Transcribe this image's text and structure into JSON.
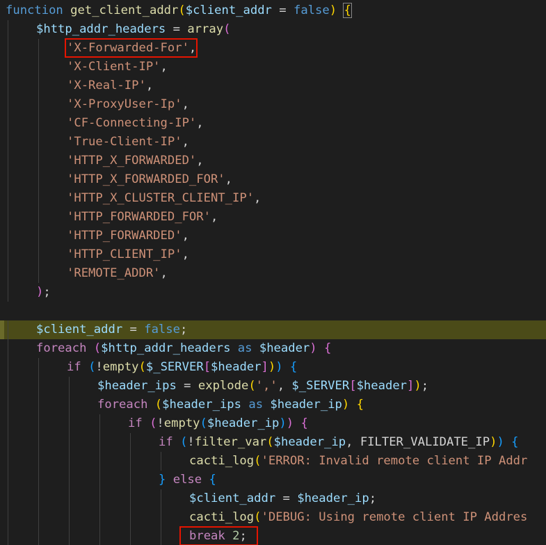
{
  "editor": {
    "lines": [
      [
        [
          "kw",
          "function"
        ],
        [
          "pl",
          " "
        ],
        [
          "fn",
          "get_client_addr"
        ],
        [
          "b1",
          "("
        ],
        [
          "var",
          "$client_addr"
        ],
        [
          "pl",
          " = "
        ],
        [
          "kw",
          "false"
        ],
        [
          "b1",
          ")"
        ],
        [
          "pl",
          " "
        ],
        [
          "b1",
          "{"
        ]
      ],
      [
        [
          "var",
          "$http_addr_headers"
        ],
        [
          "pl",
          " = "
        ],
        [
          "fn",
          "array"
        ],
        [
          "b2",
          "("
        ]
      ],
      [
        [
          "str",
          "'X-Forwarded-For'"
        ],
        [
          "pl",
          ","
        ]
      ],
      [
        [
          "str",
          "'X-Client-IP'"
        ],
        [
          "pl",
          ","
        ]
      ],
      [
        [
          "str",
          "'X-Real-IP'"
        ],
        [
          "pl",
          ","
        ]
      ],
      [
        [
          "str",
          "'X-ProxyUser-Ip'"
        ],
        [
          "pl",
          ","
        ]
      ],
      [
        [
          "str",
          "'CF-Connecting-IP'"
        ],
        [
          "pl",
          ","
        ]
      ],
      [
        [
          "str",
          "'True-Client-IP'"
        ],
        [
          "pl",
          ","
        ]
      ],
      [
        [
          "str",
          "'HTTP_X_FORWARDED'"
        ],
        [
          "pl",
          ","
        ]
      ],
      [
        [
          "str",
          "'HTTP_X_FORWARDED_FOR'"
        ],
        [
          "pl",
          ","
        ]
      ],
      [
        [
          "str",
          "'HTTP_X_CLUSTER_CLIENT_IP'"
        ],
        [
          "pl",
          ","
        ]
      ],
      [
        [
          "str",
          "'HTTP_FORWARDED_FOR'"
        ],
        [
          "pl",
          ","
        ]
      ],
      [
        [
          "str",
          "'HTTP_FORWARDED'"
        ],
        [
          "pl",
          ","
        ]
      ],
      [
        [
          "str",
          "'HTTP_CLIENT_IP'"
        ],
        [
          "pl",
          ","
        ]
      ],
      [
        [
          "str",
          "'REMOTE_ADDR'"
        ],
        [
          "pl",
          ","
        ]
      ],
      [
        [
          "b2",
          ")"
        ],
        [
          "pl",
          ";"
        ]
      ],
      [],
      [
        [
          "var",
          "$client_addr"
        ],
        [
          "pl",
          " = "
        ],
        [
          "kw",
          "false"
        ],
        [
          "pl",
          ";"
        ]
      ],
      [
        [
          "kc",
          "foreach"
        ],
        [
          "pl",
          " "
        ],
        [
          "b2",
          "("
        ],
        [
          "var",
          "$http_addr_headers"
        ],
        [
          "pl",
          " "
        ],
        [
          "kw",
          "as"
        ],
        [
          "pl",
          " "
        ],
        [
          "var",
          "$header"
        ],
        [
          "b2",
          ")"
        ],
        [
          "pl",
          " "
        ],
        [
          "b2",
          "{"
        ]
      ],
      [
        [
          "kc",
          "if"
        ],
        [
          "pl",
          " "
        ],
        [
          "b3",
          "("
        ],
        [
          "pl",
          "!"
        ],
        [
          "fn",
          "empty"
        ],
        [
          "b1",
          "("
        ],
        [
          "var",
          "$_SERVER"
        ],
        [
          "b2",
          "["
        ],
        [
          "var",
          "$header"
        ],
        [
          "b2",
          "]"
        ],
        [
          "b1",
          ")"
        ],
        [
          "b3",
          ")"
        ],
        [
          "pl",
          " "
        ],
        [
          "b3",
          "{"
        ]
      ],
      [
        [
          "var",
          "$header_ips"
        ],
        [
          "pl",
          " = "
        ],
        [
          "fn",
          "explode"
        ],
        [
          "b1",
          "("
        ],
        [
          "str",
          "','"
        ],
        [
          "pl",
          ", "
        ],
        [
          "var",
          "$_SERVER"
        ],
        [
          "b2",
          "["
        ],
        [
          "var",
          "$header"
        ],
        [
          "b2",
          "]"
        ],
        [
          "b1",
          ")"
        ],
        [
          "pl",
          ";"
        ]
      ],
      [
        [
          "kc",
          "foreach"
        ],
        [
          "pl",
          " "
        ],
        [
          "b1",
          "("
        ],
        [
          "var",
          "$header_ips"
        ],
        [
          "pl",
          " "
        ],
        [
          "kw",
          "as"
        ],
        [
          "pl",
          " "
        ],
        [
          "var",
          "$header_ip"
        ],
        [
          "b1",
          ")"
        ],
        [
          "pl",
          " "
        ],
        [
          "b1",
          "{"
        ]
      ],
      [
        [
          "kc",
          "if"
        ],
        [
          "pl",
          " "
        ],
        [
          "b2",
          "("
        ],
        [
          "pl",
          "!"
        ],
        [
          "fn",
          "empty"
        ],
        [
          "b3",
          "("
        ],
        [
          "var",
          "$header_ip"
        ],
        [
          "b3",
          ")"
        ],
        [
          "b2",
          ")"
        ],
        [
          "pl",
          " "
        ],
        [
          "b2",
          "{"
        ]
      ],
      [
        [
          "kc",
          "if"
        ],
        [
          "pl",
          " "
        ],
        [
          "b3",
          "("
        ],
        [
          "pl",
          "!"
        ],
        [
          "fn",
          "filter_var"
        ],
        [
          "b1",
          "("
        ],
        [
          "var",
          "$header_ip"
        ],
        [
          "pl",
          ", "
        ],
        [
          "pl",
          "FILTER_VALIDATE_IP"
        ],
        [
          "b1",
          ")"
        ],
        [
          "b3",
          ")"
        ],
        [
          "pl",
          " "
        ],
        [
          "b3",
          "{"
        ]
      ],
      [
        [
          "fn",
          "cacti_log"
        ],
        [
          "b1",
          "("
        ],
        [
          "str",
          "'ERROR: Invalid remote client IP Addr"
        ]
      ],
      [
        [
          "b3",
          "}"
        ],
        [
          "pl",
          " "
        ],
        [
          "kc",
          "else"
        ],
        [
          "pl",
          " "
        ],
        [
          "b3",
          "{"
        ]
      ],
      [
        [
          "var",
          "$client_addr"
        ],
        [
          "pl",
          " = "
        ],
        [
          "var",
          "$header_ip"
        ],
        [
          "pl",
          ";"
        ]
      ],
      [
        [
          "fn",
          "cacti_log"
        ],
        [
          "b1",
          "("
        ],
        [
          "str",
          "'DEBUG: Using remote client IP Addres"
        ]
      ],
      [
        [
          "kc",
          "break"
        ],
        [
          "pl",
          " "
        ],
        [
          "num",
          "2"
        ],
        [
          "pl",
          ";"
        ]
      ]
    ]
  },
  "colors": {
    "background": "#1e1e1e",
    "highlight_line": "#4b4b18",
    "annotation_box": "#e51400"
  }
}
